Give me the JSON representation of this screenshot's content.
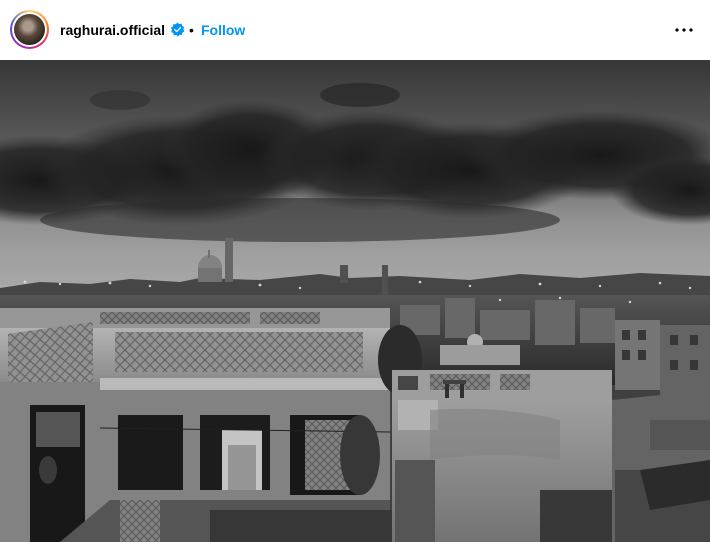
{
  "post": {
    "username": "raghurai.official",
    "separator": "•",
    "follow_label": "Follow",
    "verified": true,
    "accent_color": "#0095f6",
    "verified_color": "#0095f6"
  },
  "icons": {
    "more": "more-horizontal-icon",
    "verified": "verified-badge-icon"
  }
}
